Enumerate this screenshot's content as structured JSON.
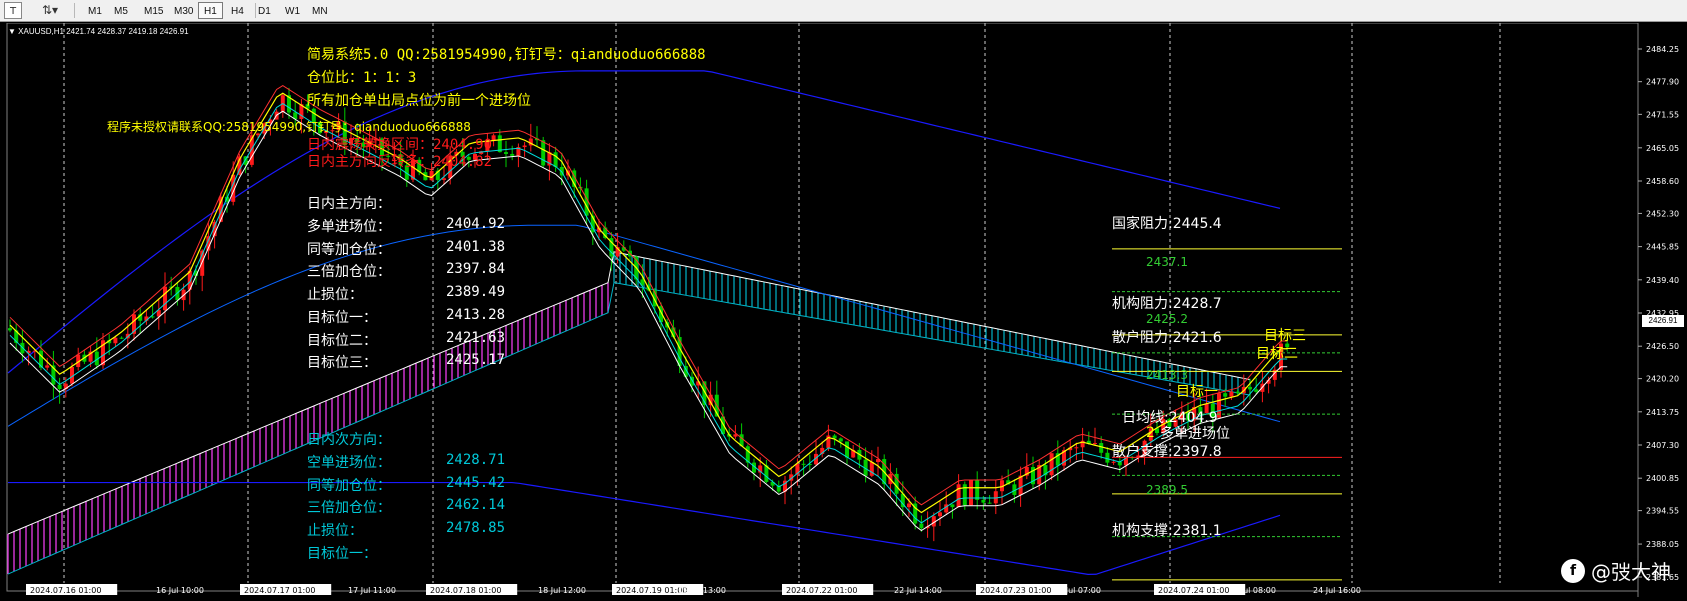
{
  "toolbar": {
    "icons": [
      "cursor-icon",
      "draw-tools-icon"
    ],
    "timeframes": [
      "M1",
      "M5",
      "M15",
      "M30",
      "H1",
      "H4",
      "D1",
      "W1",
      "MN"
    ],
    "active_timeframe": "H1"
  },
  "chart": {
    "symbol_label": "XAUUSD,H1",
    "ohlc": "2421.74 2428.37 2419.18 2426.91",
    "current_price": "2426.91",
    "price_ticks": [
      "2484.25",
      "2477.90",
      "2471.55",
      "2465.05",
      "2458.60",
      "2452.30",
      "2445.85",
      "2439.40",
      "2432.95",
      "2426.50",
      "2420.20",
      "2413.75",
      "2407.30",
      "2400.85",
      "2394.55",
      "2388.05",
      "2381.65"
    ],
    "time_labels": [
      "2024.07.16 01:00",
      "16 Jul 10:00",
      "2024.07.17 01:00",
      "17 Jul 11:00",
      "2024.07.18 01:00",
      "18 Jul 12:00",
      "2024.07.19 01:00",
      "19 Jul 13:00",
      "2024.07.22 01:00",
      "22 Jul 14:00",
      "2024.07.23 01:00",
      "23 Jul 07:00",
      "2024.07.24 01:00",
      "24 Jul 08:00",
      "24 Jul 16:00"
    ],
    "time_labels_partial": [
      "3",
      "07:00",
      "19 Jul 05:00",
      "12 Jul 06:00",
      "22 Jul 14",
      "23 Jul 13",
      "24 Jul 16:00"
    ],
    "colors": {
      "bull": "#ff1a1a",
      "bear": "#00cc00",
      "cyan": "#00b4c8",
      "magenta": "#ff40ff",
      "blue": "#1a1aff",
      "yellow": "#ffff00",
      "level_yellow": "#ffff33",
      "level_green": "#33cc33"
    }
  },
  "info_top": {
    "line1": "简易系统5.0 QQ:2581954990,钉钉号：qianduoduo666888",
    "line2": "仓位比：1：1：3",
    "line3": "所有加仓单出局点位为前一个进场位",
    "unauthorized": "程序未授权请联系QQ:2581954990,钉钉号：qianduoduo666888",
    "red1": "日内震荡转换区间：2404.90",
    "red2": "日内主方向反转多：2404.82"
  },
  "main_direction": {
    "title": "日内主方向：",
    "rows": [
      {
        "label": "多单进场位：",
        "value": "2404.92"
      },
      {
        "label": "同等加仓位：",
        "value": "2401.38"
      },
      {
        "label": "三倍加仓位：",
        "value": "2397.84"
      },
      {
        "label": "止损位：",
        "value": "2389.49"
      },
      {
        "label": "目标位一：",
        "value": "2413.28"
      },
      {
        "label": "目标位二：",
        "value": "2421.63"
      },
      {
        "label": "目标位三：",
        "value": "2425.17"
      }
    ]
  },
  "secondary_direction": {
    "title": "日内次方向：",
    "rows": [
      {
        "label": "空单进场位：",
        "value": "2428.71"
      },
      {
        "label": "同等加仓位：",
        "value": "2445.42"
      },
      {
        "label": "三倍加仓位：",
        "value": "2462.14"
      },
      {
        "label": "止损位：",
        "value": "2478.85"
      },
      {
        "label": "目标位一：",
        "value": ""
      }
    ]
  },
  "levels": {
    "guojia": "国家阻力:2445.4",
    "g2437": "2437.1",
    "jigou_resist": "机构阻力:2428.7",
    "g2425": "2425.2",
    "sanhu_resist": "散户阻力:2421.6",
    "g2413": "2413.3",
    "daily_ma": "日均线:2404.9",
    "long_entry": "多单进场位",
    "sanhu_support": "散户支撑:2397.8",
    "g2389": "2389.5",
    "jigou_support": "机构支撑:2381.1",
    "target1": "目标一",
    "target2": "目标二",
    "target3": "目标三",
    "num_2": "2"
  },
  "watermark": {
    "icon_letter": "f",
    "text": "@弢大神"
  }
}
